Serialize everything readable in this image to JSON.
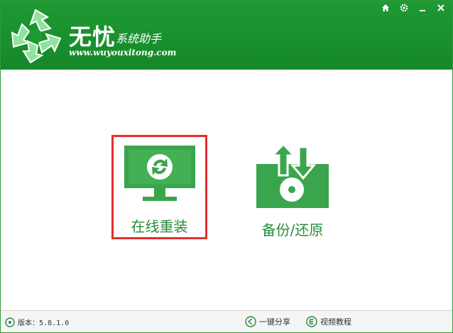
{
  "app": {
    "title": "无忧",
    "subtitle": "系统助手",
    "url": "www.wuyouxitong.com"
  },
  "window_controls": [
    "home-icon",
    "gear-icon",
    "minimize-icon",
    "close-icon"
  ],
  "features": [
    {
      "label": "在线重装",
      "icon": "monitor-refresh-icon",
      "selected": true
    },
    {
      "label": "备份/还原",
      "icon": "drive-backup-icon",
      "selected": false
    }
  ],
  "footer": {
    "version": "版本：5.8.1.0",
    "share": "一键分享",
    "video": "视频教程"
  },
  "colors": {
    "brand_green": "#1f9a33",
    "icon_green": "#3aa54c",
    "highlight_border": "#e52d2d"
  }
}
